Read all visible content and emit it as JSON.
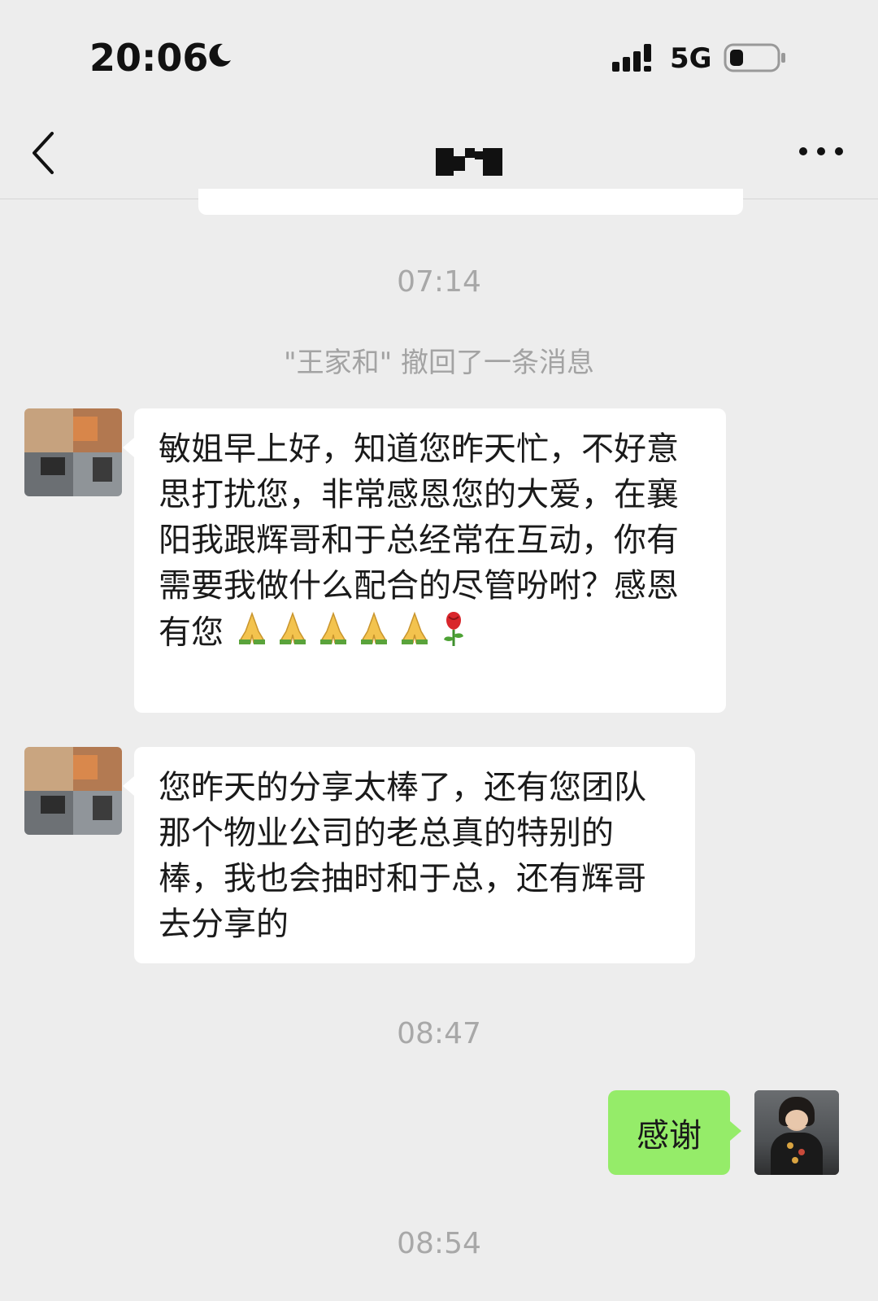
{
  "status_bar": {
    "time": "20:06",
    "network": "5G"
  },
  "icons": {
    "moon": "moon-icon",
    "signal": "signal-icon",
    "battery": "battery-icon",
    "back": "chevron-left-icon",
    "more": "more-icon",
    "pray": "folded-hands-emoji",
    "rose": "rose-emoji"
  },
  "chat": {
    "timestamps": [
      "07:14",
      "08:47",
      "08:54"
    ],
    "system_message": "\"王家和\" 撤回了一条消息",
    "messages": [
      {
        "side": "left",
        "text": "敏姐早上好，知道您昨天忙，不好意思打扰您，非常感恩您的大爱，在襄阳我跟辉哥和于总经常在互动，你有需要我做什么配合的尽管吩咐？感恩有您",
        "emojis": [
          "🙏",
          "🙏",
          "🙏",
          "🙏",
          "🙏",
          "🌹"
        ]
      },
      {
        "side": "left",
        "text": "您昨天的分享太棒了，还有您团队那个物业公司的老总真的特别的棒，我也会抽时和于总，还有辉哥去分享的"
      },
      {
        "side": "right",
        "text": "感谢"
      }
    ]
  },
  "colors": {
    "background": "#ededed",
    "bubble_incoming": "#ffffff",
    "bubble_outgoing": "#95ec69",
    "timestamp": "#a8a8a8"
  }
}
